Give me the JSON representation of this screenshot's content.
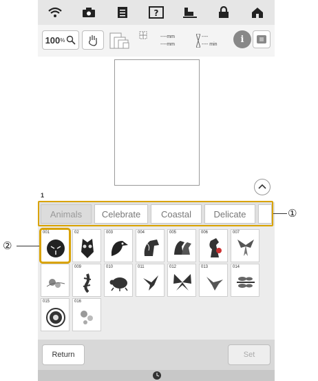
{
  "toolbar": {
    "zoom_value": "100",
    "zoom_unit": "%",
    "width_value": "----",
    "width_unit": "mm",
    "height_value": "----",
    "height_unit": "mm",
    "time_value": "----",
    "time_unit": "min"
  },
  "page_number": "1",
  "tabs": [
    "Animals",
    "Celebrate",
    "Coastal",
    "Delicate"
  ],
  "patterns": [
    "001",
    "02",
    "003",
    "004",
    "005",
    "006",
    "007",
    "008",
    "009",
    "010",
    "011",
    "012",
    "013",
    "014",
    "015",
    "016"
  ],
  "buttons": {
    "return": "Return",
    "set": "Set"
  },
  "callouts": {
    "one": "①",
    "two": "②"
  },
  "colors": {
    "accent": "#d9a300",
    "screen_bg": "#ececec"
  }
}
